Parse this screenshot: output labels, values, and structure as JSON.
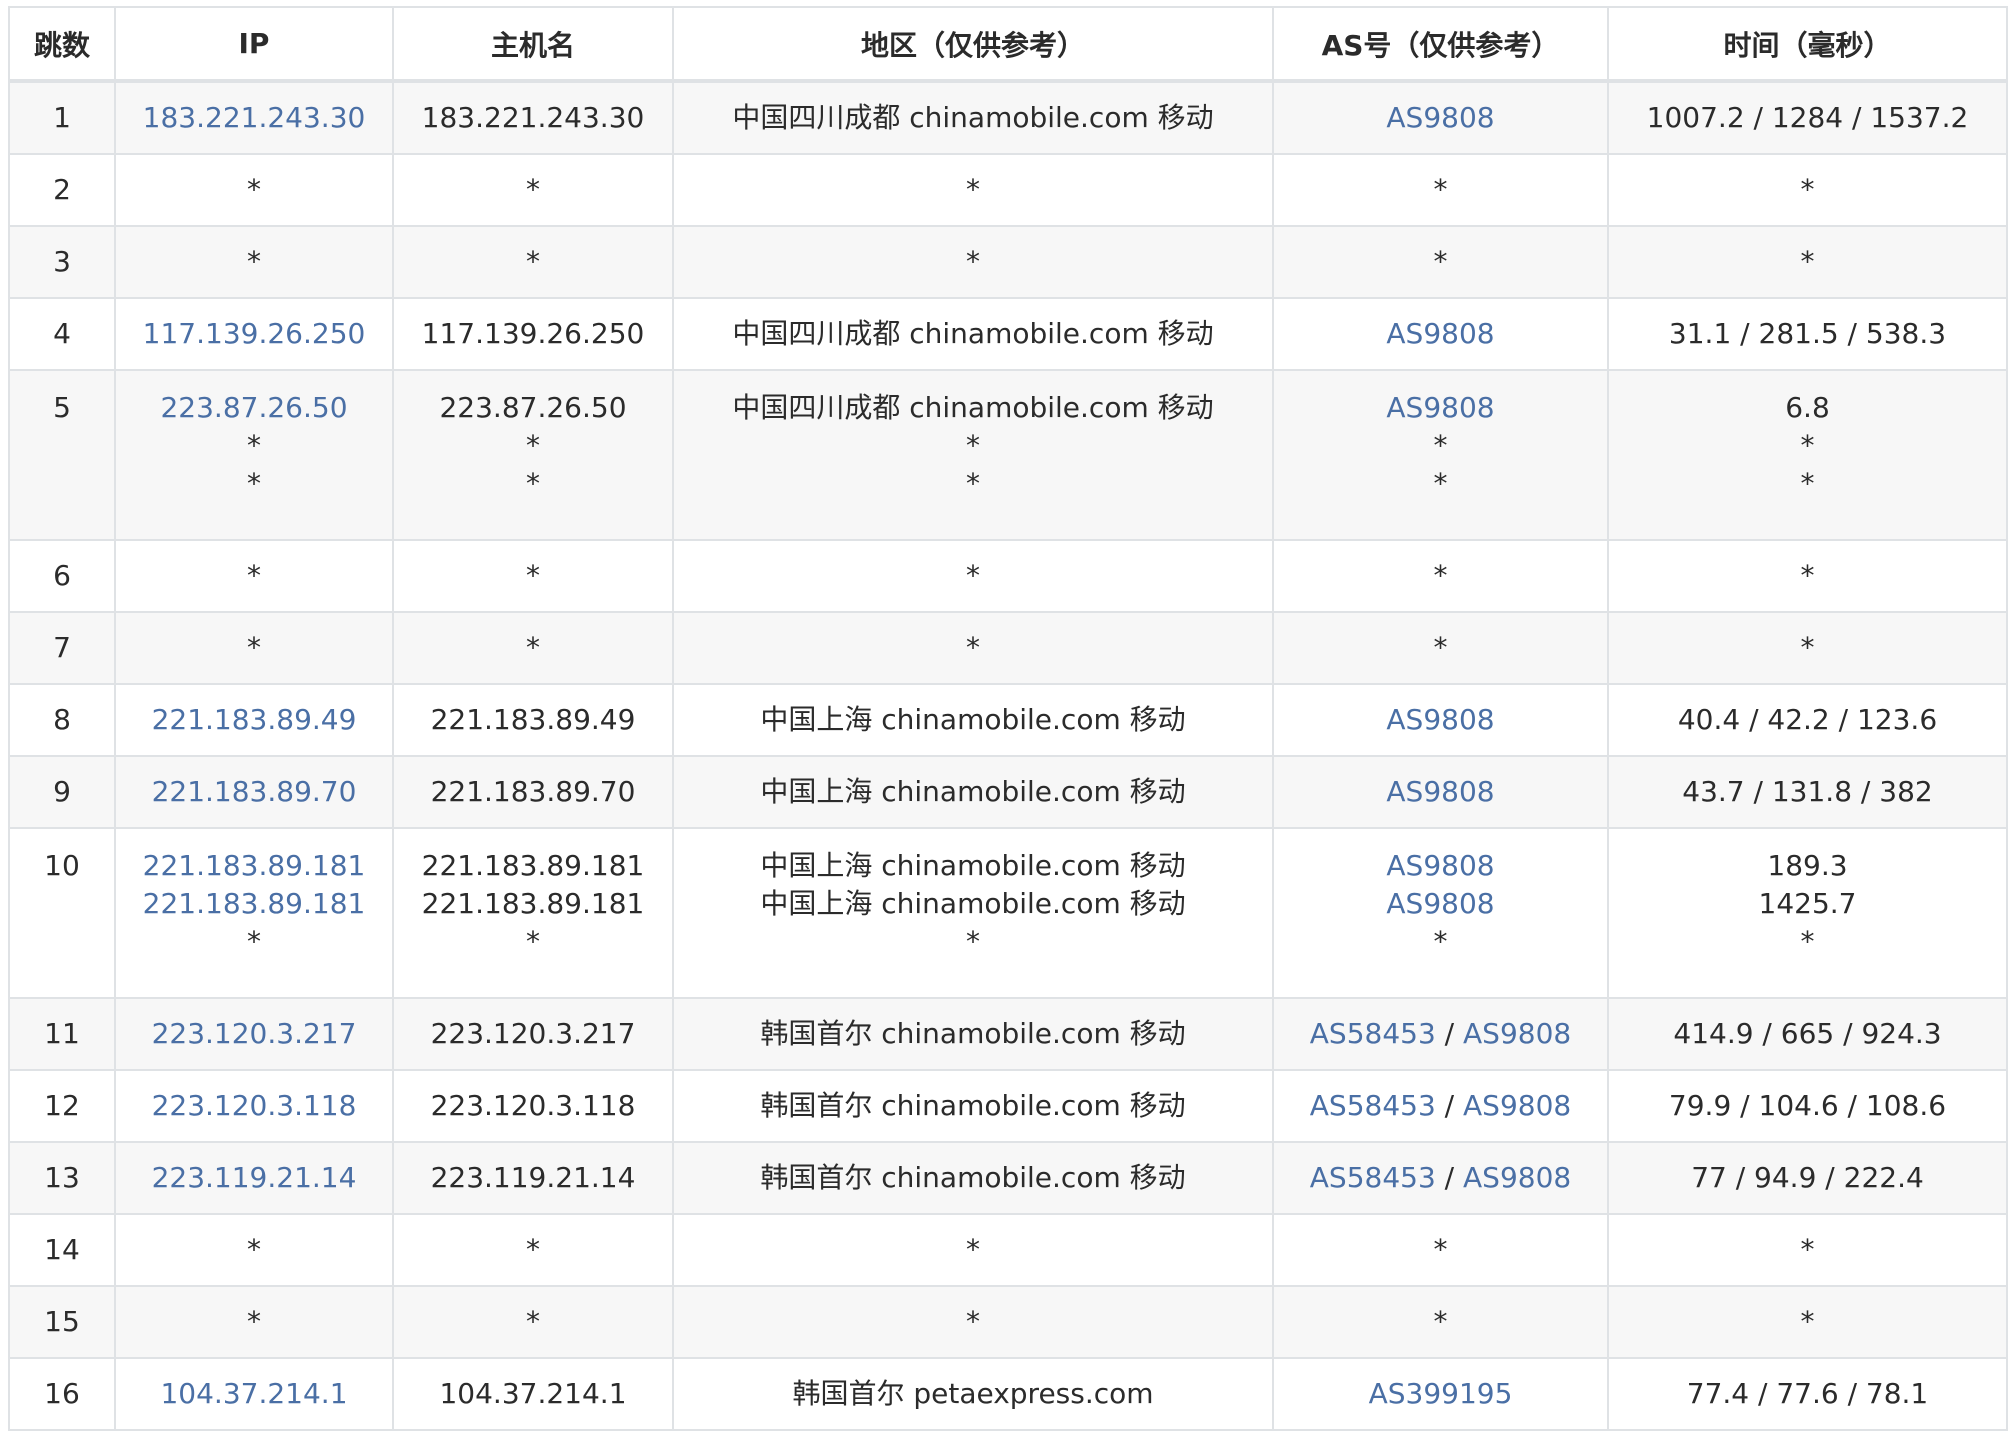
{
  "headers": [
    "跳数",
    "IP",
    "主机名",
    "地区（仅供参考）",
    "AS号（仅供参考）",
    "时间（毫秒）"
  ],
  "rows": [
    {
      "hop": "1",
      "lines": [
        {
          "ip": "183.221.243.30",
          "host": "183.221.243.30",
          "region": "中国四川成都 chinamobile.com 移动",
          "as": [
            "AS9808"
          ],
          "time": "1007.2 / 1284 / 1537.2"
        }
      ]
    },
    {
      "hop": "2",
      "lines": [
        {
          "ip": "*",
          "host": "*",
          "region": "*",
          "as": [
            "*"
          ],
          "time": "*"
        }
      ]
    },
    {
      "hop": "3",
      "lines": [
        {
          "ip": "*",
          "host": "*",
          "region": "*",
          "as": [
            "*"
          ],
          "time": "*"
        }
      ]
    },
    {
      "hop": "4",
      "lines": [
        {
          "ip": "117.139.26.250",
          "host": "117.139.26.250",
          "region": "中国四川成都 chinamobile.com 移动",
          "as": [
            "AS9808"
          ],
          "time": "31.1 / 281.5 / 538.3"
        }
      ]
    },
    {
      "hop": "5",
      "lines": [
        {
          "ip": "223.87.26.50",
          "host": "223.87.26.50",
          "region": "中国四川成都 chinamobile.com 移动",
          "as": [
            "AS9808"
          ],
          "time": "6.8"
        },
        {
          "ip": "*",
          "host": "*",
          "region": "*",
          "as": [
            "*"
          ],
          "time": "*"
        },
        {
          "ip": "*",
          "host": "*",
          "region": "*",
          "as": [
            "*"
          ],
          "time": "*"
        }
      ]
    },
    {
      "hop": "6",
      "lines": [
        {
          "ip": "*",
          "host": "*",
          "region": "*",
          "as": [
            "*"
          ],
          "time": "*"
        }
      ]
    },
    {
      "hop": "7",
      "lines": [
        {
          "ip": "*",
          "host": "*",
          "region": "*",
          "as": [
            "*"
          ],
          "time": "*"
        }
      ]
    },
    {
      "hop": "8",
      "lines": [
        {
          "ip": "221.183.89.49",
          "host": "221.183.89.49",
          "region": "中国上海 chinamobile.com 移动",
          "as": [
            "AS9808"
          ],
          "time": "40.4 / 42.2 / 123.6"
        }
      ]
    },
    {
      "hop": "9",
      "lines": [
        {
          "ip": "221.183.89.70",
          "host": "221.183.89.70",
          "region": "中国上海 chinamobile.com 移动",
          "as": [
            "AS9808"
          ],
          "time": "43.7 / 131.8 / 382"
        }
      ]
    },
    {
      "hop": "10",
      "lines": [
        {
          "ip": "221.183.89.181",
          "host": "221.183.89.181",
          "region": "中国上海 chinamobile.com 移动",
          "as": [
            "AS9808"
          ],
          "time": "189.3"
        },
        {
          "ip": "221.183.89.181",
          "host": "221.183.89.181",
          "region": "中国上海 chinamobile.com 移动",
          "as": [
            "AS9808"
          ],
          "time": "1425.7"
        },
        {
          "ip": "*",
          "host": "*",
          "region": "*",
          "as": [
            "*"
          ],
          "time": "*"
        }
      ]
    },
    {
      "hop": "11",
      "lines": [
        {
          "ip": "223.120.3.217",
          "host": "223.120.3.217",
          "region": "韩国首尔 chinamobile.com 移动",
          "as": [
            "AS58453",
            "AS9808"
          ],
          "time": "414.9 / 665 / 924.3"
        }
      ]
    },
    {
      "hop": "12",
      "lines": [
        {
          "ip": "223.120.3.118",
          "host": "223.120.3.118",
          "region": "韩国首尔 chinamobile.com 移动",
          "as": [
            "AS58453",
            "AS9808"
          ],
          "time": "79.9 / 104.6 / 108.6"
        }
      ]
    },
    {
      "hop": "13",
      "lines": [
        {
          "ip": "223.119.21.14",
          "host": "223.119.21.14",
          "region": "韩国首尔 chinamobile.com 移动",
          "as": [
            "AS58453",
            "AS9808"
          ],
          "time": "77 / 94.9 / 222.4"
        }
      ]
    },
    {
      "hop": "14",
      "lines": [
        {
          "ip": "*",
          "host": "*",
          "region": "*",
          "as": [
            "*"
          ],
          "time": "*"
        }
      ]
    },
    {
      "hop": "15",
      "lines": [
        {
          "ip": "*",
          "host": "*",
          "region": "*",
          "as": [
            "*"
          ],
          "time": "*"
        }
      ]
    },
    {
      "hop": "16",
      "lines": [
        {
          "ip": "104.37.214.1",
          "host": "104.37.214.1",
          "region": "韩国首尔 petaexpress.com",
          "as": [
            "AS399195"
          ],
          "time": "77.4 / 77.6 / 78.1"
        }
      ]
    }
  ],
  "as_separator": " / ",
  "colors": {
    "link": "#4a6fa5",
    "text": "#2b2b2b",
    "border": "#dfe2e5",
    "alt_row": "#f7f7f7"
  }
}
